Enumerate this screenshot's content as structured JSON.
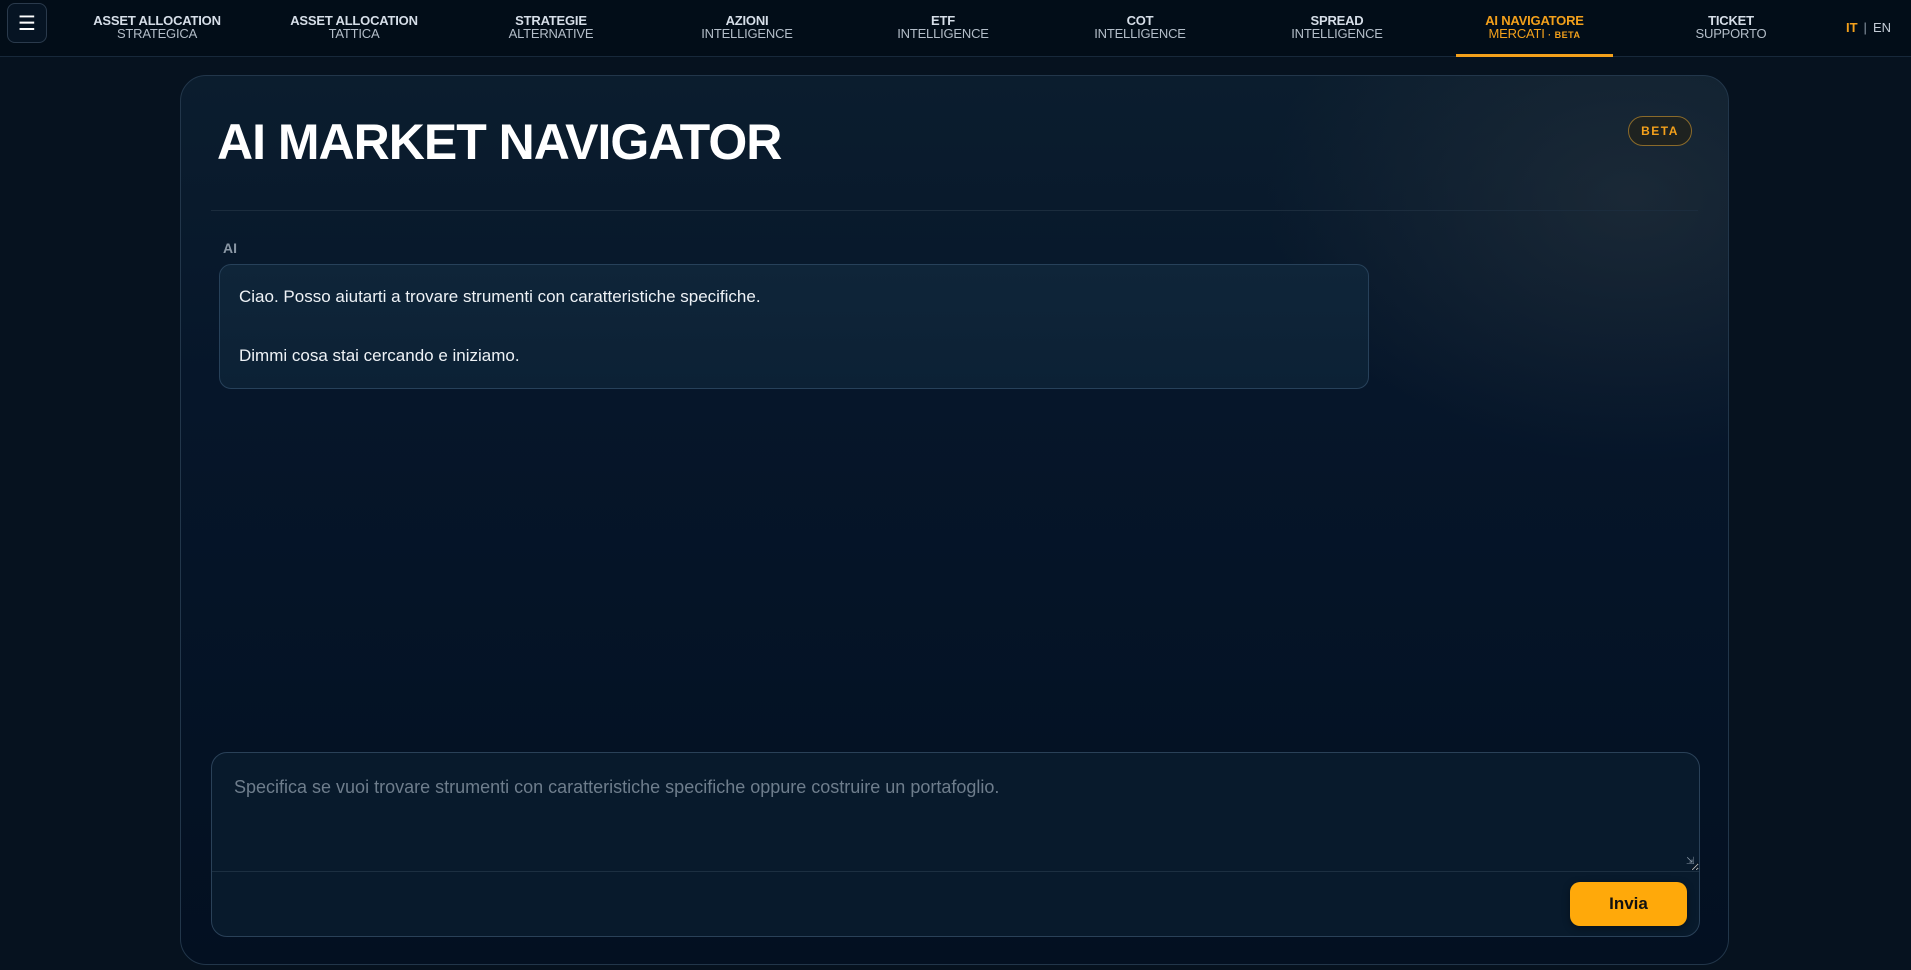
{
  "nav": {
    "menu_icon": "hamburger-icon",
    "items": [
      {
        "line1": "ASSET ALLOCATION",
        "line2": "STRATEGICA"
      },
      {
        "line1": "ASSET ALLOCATION",
        "line2": "TATTICA"
      },
      {
        "line1": "STRATEGIE",
        "line2": "ALTERNATIVE"
      },
      {
        "line1": "AZIONI",
        "line2": "INTELLIGENCE"
      },
      {
        "line1": "ETF",
        "line2": "INTELLIGENCE"
      },
      {
        "line1": "COT",
        "line2": "INTELLIGENCE"
      },
      {
        "line1": "SPREAD",
        "line2": "INTELLIGENCE"
      },
      {
        "line1": "AI NAVIGATORE",
        "line2": "MERCATI",
        "tag": "· BETA"
      },
      {
        "line1": "TICKET",
        "line2": "SUPPORTO"
      }
    ],
    "active_index": 7,
    "lang": {
      "it": "IT",
      "separator": "|",
      "en": "EN",
      "active": "IT"
    }
  },
  "header": {
    "title": "AI MARKET NAVIGATOR",
    "badge": "BETA"
  },
  "chat": {
    "messages": [
      {
        "sender": "AI",
        "paragraphs": [
          "Ciao. Posso aiutarti a trovare strumenti con caratteristiche specifiche.",
          "Dimmi cosa stai cercando e iniziamo."
        ]
      }
    ]
  },
  "composer": {
    "value": "",
    "placeholder": "Specifica se vuoi trovare strumenti con caratteristiche specifiche oppure costruire un portafoglio.",
    "send_label": "Invia"
  },
  "colors": {
    "accent": "#f3a01b",
    "button": "#ffa90a",
    "background": "#06121f"
  }
}
